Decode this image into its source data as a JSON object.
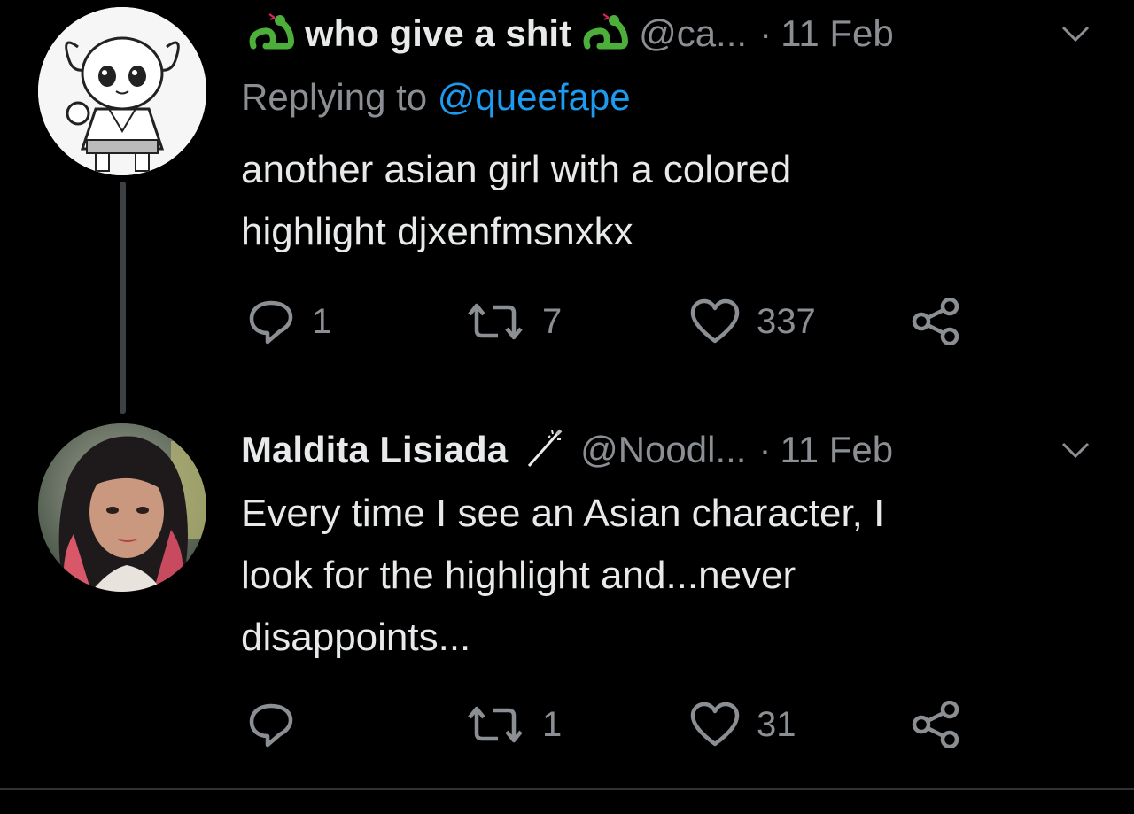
{
  "tweets": [
    {
      "name": "who give a shit",
      "name_emoji": "snake-icon",
      "handle": "@ca...",
      "dot": "·",
      "date": "11 Feb",
      "replying_prefix": "Replying to",
      "replying_to": "@queefape",
      "text_line1": "another asian girl with a colored",
      "text_line2": "highlight djxenfmsnxkx",
      "reply_count": "1",
      "retweet_count": "7",
      "like_count": "337"
    },
    {
      "name": "Maldita Lisiada",
      "name_emoji": "wand-icon",
      "handle": "@Noodl...",
      "dot": "·",
      "date": "11 Feb",
      "text_line1": "Every time I see an Asian character, I",
      "text_line2": "look for the highlight and...never",
      "text_line3": "disappoints...",
      "reply_count": "",
      "retweet_count": "1",
      "like_count": "31"
    }
  ],
  "colors": {
    "background": "#000000",
    "text": "#e7e9ea",
    "muted": "#8b8f93",
    "mention": "#1d9bf0",
    "snake": "#4caf3a"
  }
}
